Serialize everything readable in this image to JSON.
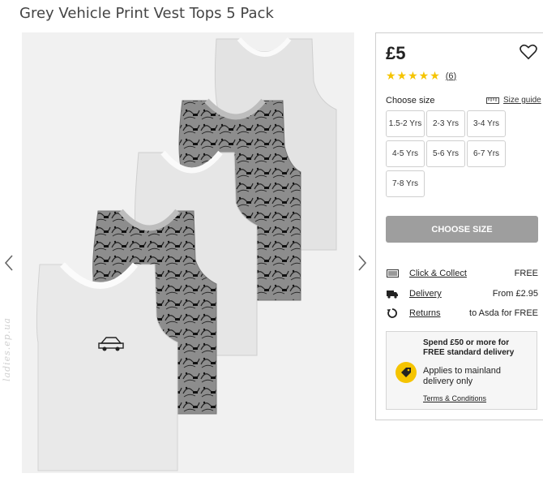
{
  "product": {
    "title": "Grey Vehicle Print Vest Tops 5 Pack",
    "price": "£5",
    "rating_stars": "★★★★★",
    "review_count": "(6)"
  },
  "size": {
    "label": "Choose size",
    "guide_label": "Size guide",
    "options": [
      "1.5-2 Yrs",
      "2-3 Yrs",
      "3-4 Yrs",
      "4-5 Yrs",
      "5-6 Yrs",
      "6-7 Yrs",
      "7-8 Yrs"
    ],
    "button_label": "CHOOSE SIZE"
  },
  "delivery": [
    {
      "icon": "store-icon",
      "label": "Click & Collect",
      "value": "FREE"
    },
    {
      "icon": "truck-icon",
      "label": "Delivery",
      "value": "From £2.95"
    },
    {
      "icon": "returns-icon",
      "label": "Returns",
      "value": "to Asda for FREE"
    }
  ],
  "promo": {
    "headline": "Spend £50 or more for FREE standard delivery",
    "note": "Applies to mainland delivery only",
    "terms": "Terms & Conditions"
  },
  "watermark": "ladies.ep.ua",
  "colors": {
    "star": "#f5c400",
    "button_disabled": "#9e9e9e",
    "promo_tag": "#f5c400"
  }
}
